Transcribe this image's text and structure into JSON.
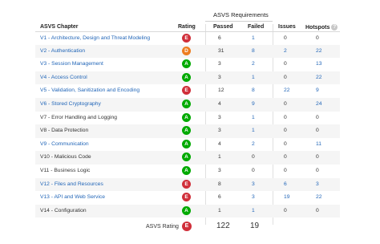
{
  "header": {
    "group_title": "ASVS Requirements",
    "chapter": "ASVS Chapter",
    "rating": "Rating",
    "passed": "Passed",
    "failed": "Failed",
    "issues": "Issues",
    "hotspots": "Hotspots",
    "help_icon": "?"
  },
  "colors": {
    "rating_E": "#d02f3a",
    "rating_D": "#ed7d20",
    "rating_A": "#00aa00",
    "link": "#2266b8"
  },
  "rows": [
    {
      "chapter": "V1 - Architecture, Design and Threat Modeling",
      "rating": "E",
      "passed": "6",
      "failed": "1",
      "issues": "0",
      "hotspots": "0"
    },
    {
      "chapter": "V2 - Authentication",
      "rating": "D",
      "passed": "31",
      "failed": "8",
      "issues": "2",
      "hotspots": "22"
    },
    {
      "chapter": "V3 - Session Management",
      "rating": "A",
      "passed": "3",
      "failed": "2",
      "issues": "0",
      "hotspots": "13"
    },
    {
      "chapter": "V4 - Access Control",
      "rating": "A",
      "passed": "3",
      "failed": "1",
      "issues": "0",
      "hotspots": "22"
    },
    {
      "chapter": "V5 - Validation, Sanitization and Encoding",
      "rating": "E",
      "passed": "12",
      "failed": "8",
      "issues": "22",
      "hotspots": "9"
    },
    {
      "chapter": "V6 - Stored Cryptography",
      "rating": "A",
      "passed": "4",
      "failed": "9",
      "issues": "0",
      "hotspots": "24"
    },
    {
      "chapter": "V7 - Error Handling and Logging",
      "rating": "A",
      "passed": "3",
      "failed": "1",
      "issues": "0",
      "hotspots": "0"
    },
    {
      "chapter": "V8 - Data Protection",
      "rating": "A",
      "passed": "3",
      "failed": "1",
      "issues": "0",
      "hotspots": "0"
    },
    {
      "chapter": "V9 - Communication",
      "rating": "A",
      "passed": "4",
      "failed": "2",
      "issues": "0",
      "hotspots": "11"
    },
    {
      "chapter": "V10 - Malicious Code",
      "rating": "A",
      "passed": "1",
      "failed": "0",
      "issues": "0",
      "hotspots": "0"
    },
    {
      "chapter": "V11 - Business Logic",
      "rating": "A",
      "passed": "3",
      "failed": "0",
      "issues": "0",
      "hotspots": "0"
    },
    {
      "chapter": "V12 - Files and Resources",
      "rating": "E",
      "passed": "8",
      "failed": "3",
      "issues": "6",
      "hotspots": "3"
    },
    {
      "chapter": "V13 - API and Web Service",
      "rating": "E",
      "passed": "6",
      "failed": "3",
      "issues": "19",
      "hotspots": "22"
    },
    {
      "chapter": "V14 - Configuration",
      "rating": "A",
      "passed": "1",
      "failed": "1",
      "issues": "0",
      "hotspots": "0"
    }
  ],
  "footer": {
    "label": "ASVS Rating",
    "rating": "E",
    "passed_total": "122",
    "failed_total": "19"
  }
}
